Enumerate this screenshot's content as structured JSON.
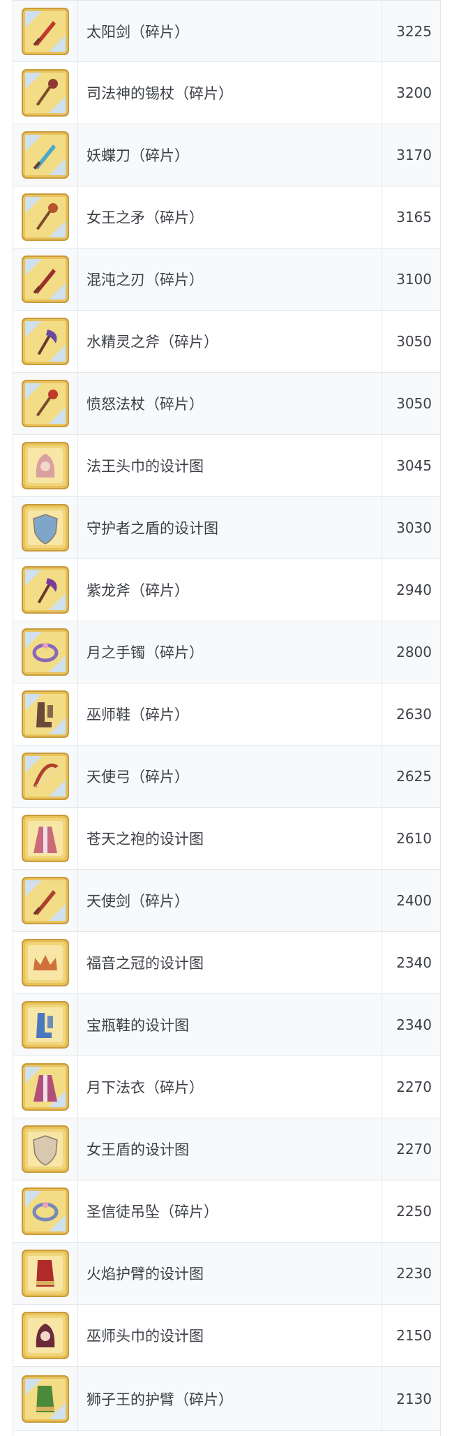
{
  "items": [
    {
      "name": "太阳剑（碎片）",
      "value": "3225",
      "icon": "sword-shard-icon",
      "frame": "shard",
      "color": "#c0392b"
    },
    {
      "name": "司法神的锡杖（碎片）",
      "value": "3200",
      "icon": "scepter-shard-icon",
      "frame": "shard",
      "color": "#8e3b2f"
    },
    {
      "name": "妖蝶刀（碎片）",
      "value": "3170",
      "icon": "blade-shard-icon",
      "frame": "shard",
      "color": "#4aa8c8"
    },
    {
      "name": "女王之矛（碎片）",
      "value": "3165",
      "icon": "spear-shard-icon",
      "frame": "shard",
      "color": "#b5532e"
    },
    {
      "name": "混沌之刃（碎片）",
      "value": "3100",
      "icon": "blade-shard-icon",
      "frame": "shard",
      "color": "#9b2d2d"
    },
    {
      "name": "水精灵之斧（碎片）",
      "value": "3050",
      "icon": "axe-shard-icon",
      "frame": "shard",
      "color": "#6a4aa0"
    },
    {
      "name": "愤怒法杖（碎片）",
      "value": "3050",
      "icon": "staff-shard-icon",
      "frame": "shard",
      "color": "#c0392b"
    },
    {
      "name": "法王头巾的设计图",
      "value": "3045",
      "icon": "hood-blueprint-icon",
      "frame": "blueprint",
      "color": "#d9a0a0"
    },
    {
      "name": "守护者之盾的设计图",
      "value": "3030",
      "icon": "shield-blueprint-icon",
      "frame": "blueprint",
      "color": "#7fa6c8"
    },
    {
      "name": "紫龙斧（碎片）",
      "value": "2940",
      "icon": "axe-shard-icon",
      "frame": "shard",
      "color": "#7a3e9a"
    },
    {
      "name": "月之手镯（碎片）",
      "value": "2800",
      "icon": "bracelet-shard-icon",
      "frame": "shard",
      "color": "#8a68b8"
    },
    {
      "name": "巫师鞋（碎片）",
      "value": "2630",
      "icon": "boots-shard-icon",
      "frame": "shard",
      "color": "#6b4a3a"
    },
    {
      "name": "天使弓（碎片）",
      "value": "2625",
      "icon": "bow-shard-icon",
      "frame": "shard",
      "color": "#b0402e"
    },
    {
      "name": "苍天之袍的设计图",
      "value": "2610",
      "icon": "robe-blueprint-icon",
      "frame": "blueprint",
      "color": "#c86a7a"
    },
    {
      "name": "天使剑（碎片）",
      "value": "2400",
      "icon": "sword-shard-icon",
      "frame": "shard",
      "color": "#b0402e"
    },
    {
      "name": "福音之冠的设计图",
      "value": "2340",
      "icon": "crown-blueprint-icon",
      "frame": "blueprint",
      "color": "#d0703a"
    },
    {
      "name": "宝瓶鞋的设计图",
      "value": "2340",
      "icon": "boots-blueprint-icon",
      "frame": "blueprint",
      "color": "#4a78c0"
    },
    {
      "name": "月下法衣（碎片）",
      "value": "2270",
      "icon": "robe-shard-icon",
      "frame": "shard",
      "color": "#b0507a"
    },
    {
      "name": "女王盾的设计图",
      "value": "2270",
      "icon": "shield-blueprint-icon",
      "frame": "blueprint",
      "color": "#d8c8b0"
    },
    {
      "name": "圣信徒吊坠（碎片）",
      "value": "2250",
      "icon": "pendant-shard-icon",
      "frame": "shard",
      "color": "#7a88b8"
    },
    {
      "name": "火焰护臂的设计图",
      "value": "2230",
      "icon": "gauntlet-blueprint-icon",
      "frame": "blueprint",
      "color": "#b02a2a"
    },
    {
      "name": "巫师头巾的设计图",
      "value": "2150",
      "icon": "hood-blueprint-icon",
      "frame": "blueprint",
      "color": "#6a2a3a"
    },
    {
      "name": "狮子王的护臂（碎片）",
      "value": "2130",
      "icon": "gauntlet-shard-icon",
      "frame": "shard",
      "color": "#4a8a3a"
    }
  ]
}
